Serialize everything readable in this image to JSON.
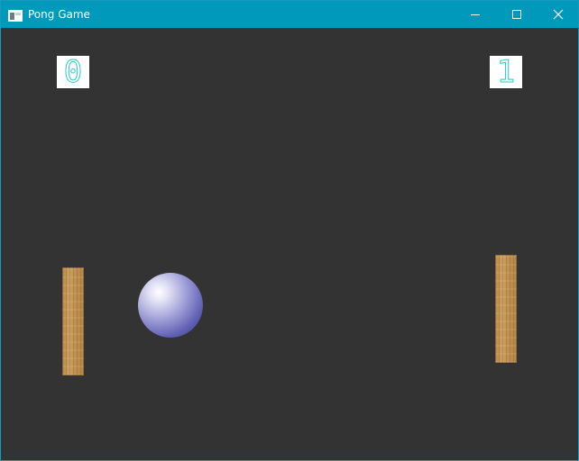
{
  "window": {
    "title": "Pong Game",
    "app_icon": "window-app-icon",
    "controls": [
      "minimize-icon",
      "maximize-icon",
      "close-icon"
    ],
    "accent_color": "#0099bb"
  },
  "game": {
    "background_color": "#333333",
    "score_left": "0",
    "score_right": "1",
    "score_color": "#2fc7c7",
    "paddle_style": "wood",
    "ball_color": "#5f5fb4"
  }
}
